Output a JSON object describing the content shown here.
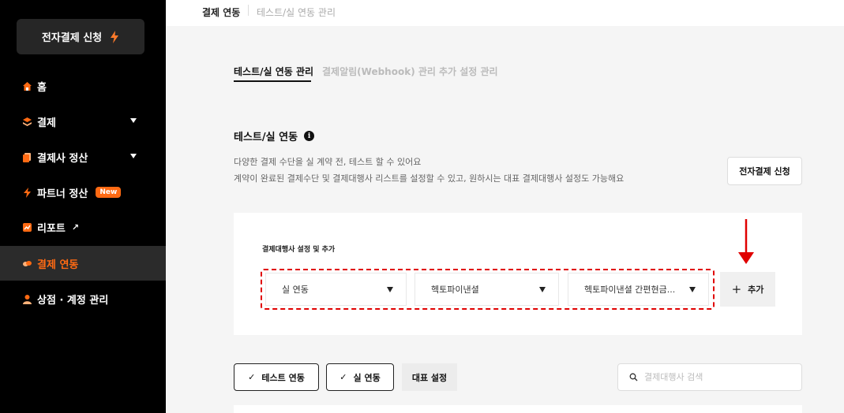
{
  "sidebar": {
    "apply_button": "전자결제 신청",
    "items": [
      {
        "label": "홈"
      },
      {
        "label": "결제"
      },
      {
        "label": "결제사 정산"
      },
      {
        "label": "파트너 정산",
        "badge": "New"
      },
      {
        "label": "리포트",
        "suffix": "↗"
      },
      {
        "label": "결제 연동"
      },
      {
        "label": "상점 · 계정 관리"
      }
    ],
    "accent_color": "#ff6a13"
  },
  "breadcrumb": {
    "current": "결제 연동",
    "sub": "테스트/실 연동 관리"
  },
  "tabs": [
    {
      "label": "테스트/실 연동 관리"
    },
    {
      "label": "결제알림(Webhook) 관리"
    },
    {
      "label": "추가 설정 관리"
    }
  ],
  "section": {
    "title": "테스트/실 연동",
    "info_icon": "i",
    "desc1": "다양한 결제 수단을 실 계약 전, 테스트 할 수 있어요",
    "desc2": "계약이 완료된 결제수단 및 결제대행사 리스트를 설정할 수 있고, 원하시는 대표 결제대행사 설정도 가능해요",
    "apply_button": "전자결제 신청"
  },
  "pg_card": {
    "label": "결제대행사 설정 및 추가",
    "select_mode": "실 연동",
    "select_pg": "헥토파이낸셜",
    "select_method": "헥토파이낸셜 간편현금...",
    "add_button": "추가",
    "add_icon": "+"
  },
  "filters": {
    "test_button": "테스트 연동",
    "real_button": "실 연동",
    "check_glyph": "✓",
    "primary_button": "대표 설정",
    "search_placeholder": "결제대행사 검색"
  }
}
